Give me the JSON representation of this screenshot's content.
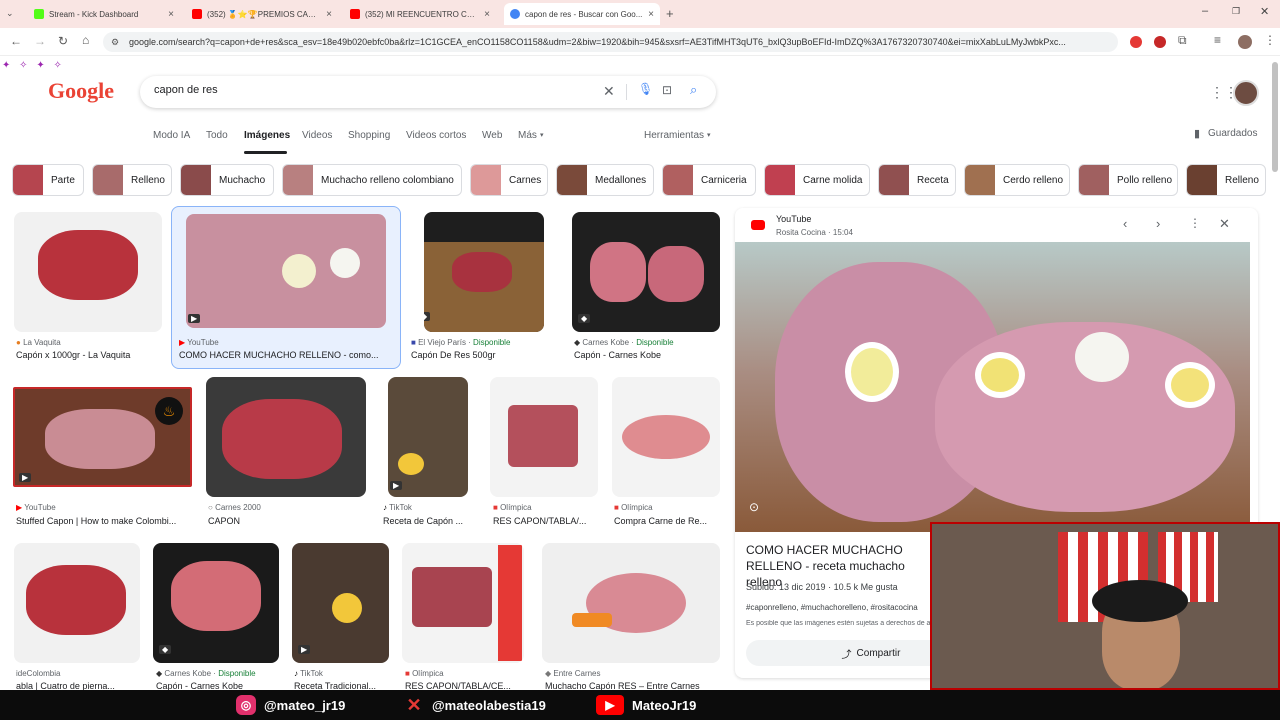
{
  "browser": {
    "tabs": [
      {
        "title": "Stream - Kick Dashboard",
        "favicon": "kick-icon",
        "color": "#53fc18"
      },
      {
        "title": "(352) 🏅⭐🏆PREMIOS CAMI...",
        "favicon": "youtube-icon",
        "color": "#ff0000"
      },
      {
        "title": "(352) MI REENCUENTRO CON ...",
        "favicon": "youtube-icon",
        "color": "#ff0000"
      },
      {
        "title": "capon de res - Buscar con Goo...",
        "favicon": "google-icon",
        "color": "#4285f4"
      }
    ],
    "url": "google.com/search?q=capon+de+res&sca_esv=18e49b020ebfc0ba&rlz=1C1GCEA_enCO1158CO1158&udm=2&biw=1920&bih=945&sxsrf=AE3TifMHT3qUT6_bxlQ3upBoEFId-ImDZQ%3A1767320730740&ei=mixXabLuLMyJwbkPxc..."
  },
  "search": {
    "logo": "Google",
    "query": "capon de res"
  },
  "nav_tabs": [
    "Modo IA",
    "Todo",
    "Imágenes",
    "Videos",
    "Shopping",
    "Videos cortos",
    "Web",
    "Más",
    "Herramientas",
    "Guardados"
  ],
  "chips": [
    "Parte",
    "Relleno",
    "Muchacho",
    "Muchacho relleno colombiano",
    "Carnes",
    "Medallones",
    "Carniceria",
    "Carne molida",
    "Receta",
    "Cerdo relleno",
    "Pollo relleno",
    "Relleno"
  ],
  "results": [
    {
      "source": "La Vaquita",
      "avail": "",
      "caption": "Capón x 1000gr - La Vaquita"
    },
    {
      "source": "YouTube",
      "avail": "",
      "caption": "COMO HACER MUCHACHO RELLENO - como..."
    },
    {
      "source": "El Viejo París",
      "avail": "Disponible",
      "caption": "Capón De Res 500gr"
    },
    {
      "source": "Carnes Kobe",
      "avail": "Disponible",
      "caption": "Capón - Carnes Kobe"
    },
    {
      "source": "YouTube",
      "avail": "",
      "caption": "Stuffed Capon | How to make Colombi..."
    },
    {
      "source": "Carnes 2000",
      "avail": "",
      "caption": "CAPON"
    },
    {
      "source": "TikTok",
      "avail": "",
      "caption": "Receta de Capón ..."
    },
    {
      "source": "Olímpica",
      "avail": "",
      "caption": "RES CAPON/TABLA/..."
    },
    {
      "source": "Olímpica",
      "avail": "",
      "caption": "Compra Carne de Re..."
    },
    {
      "source": "ideColombia",
      "avail": "",
      "caption": "abla | Cuatro de pierna..."
    },
    {
      "source": "Carnes Kobe",
      "avail": "Disponible",
      "caption": "Capón - Carnes Kobe"
    },
    {
      "source": "TikTok",
      "avail": "",
      "caption": "Receta Tradicional..."
    },
    {
      "source": "Olímpica",
      "avail": "",
      "caption": "RES CAPON/TABLA/CE..."
    },
    {
      "source": "Entre Carnes",
      "avail": "",
      "caption": "Muchacho Capón RES – Entre Carnes"
    }
  ],
  "panel": {
    "site": "YouTube",
    "channel": "Rosita Cocina",
    "duration": "15:04",
    "title": "COMO HACER MUCHACHO RELLENO - receta muchacho relleno",
    "uploaded": "Subido: 13 dic 2019",
    "likes": "10.5 k Me gusta",
    "tags": "#caponrelleno, #muchachorelleno, #rositacocina",
    "note": "Es posible que las imágenes estén sujetas a derechos de autor.",
    "share": "Compartir"
  },
  "overlay": {
    "instagram": "@mateo_jr19",
    "x": "@mateolabestia19",
    "youtube": "MateoJr19"
  },
  "colors": {
    "accent": "#1a73e8",
    "youtube": "#ff0000",
    "available": "#188038"
  }
}
